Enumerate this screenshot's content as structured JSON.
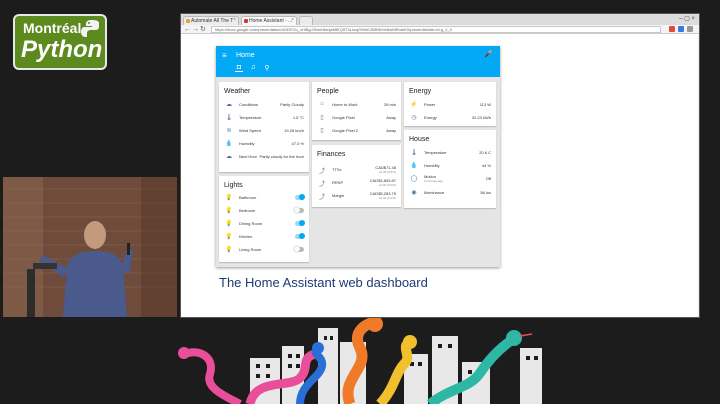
{
  "logo": {
    "line1": "Montréal",
    "line2": "Python"
  },
  "browser": {
    "tabs": [
      {
        "label": "Automate All The T",
        "active": false
      },
      {
        "label": "Home Assistant - ...",
        "active": true
      },
      {
        "label": "",
        "active": false
      }
    ],
    "url": "https://docs.google.com/presentation/d/1DFGu_xHlBgJ3NmHbmjaMtKQ5T3LkcqGWkK2BRNHxNfaMlRnrbiOi/present#slide=id.g_2_0"
  },
  "dashboard": {
    "header_title": "Home",
    "weather": {
      "title": "Weather",
      "rows": [
        {
          "icon": "☁",
          "name": "Conditions",
          "value": "Partly Cloudy"
        },
        {
          "icon": "🌡",
          "name": "Temperature",
          "value": "1.5 °C"
        },
        {
          "icon": "≋",
          "name": "Wind Speed",
          "value": "19.28 km/h"
        },
        {
          "icon": "💧",
          "name": "Humidity",
          "value": "47.0 %"
        },
        {
          "icon": "☁",
          "name": "Next Hour",
          "value": "Partly cloudy for the hour"
        }
      ]
    },
    "people": {
      "title": "People",
      "rows": [
        {
          "icon": "⌂",
          "name": "Home to Work",
          "value": "28 min"
        },
        {
          "icon": "▯",
          "name": "Google Pixel",
          "value": "Away"
        },
        {
          "icon": "▯",
          "name": "Google Pixel 2",
          "value": "Away"
        }
      ]
    },
    "energy": {
      "title": "Energy",
      "rows": [
        {
          "icon": "⚡",
          "name": "Power",
          "value": "113 W"
        },
        {
          "icon": "◷",
          "name": "Energy",
          "value": "32.23 kWh"
        }
      ]
    },
    "finances": {
      "title": "Finances",
      "rows": [
        {
          "icon": "⤴",
          "name": "TTSx",
          "value": "CAD$71.48",
          "sub": "+0.35 (0.5%)"
        },
        {
          "icon": "⤴",
          "name": "RRSP",
          "value": "CAD$3,853.87",
          "sub": "+0.00 (0.0%)"
        },
        {
          "icon": "⤴",
          "name": "Margin",
          "value": "CAD$5,283.75",
          "sub": "+0.00 (0.0%)"
        }
      ]
    },
    "house": {
      "title": "House",
      "rows": [
        {
          "icon": "🌡",
          "name": "Temperature",
          "value": "20.6 C",
          "sub": ""
        },
        {
          "icon": "💧",
          "name": "Humidity",
          "value": "44 %",
          "sub": ""
        },
        {
          "icon": "◯",
          "name": "Motion",
          "value": "Off",
          "sub": "3 minutes ago"
        },
        {
          "icon": "◉",
          "name": "Illuminance",
          "value": "58 lux",
          "sub": ""
        }
      ]
    },
    "lights": {
      "title": "Lights",
      "rows": [
        {
          "icon": "💡",
          "name": "Bathroom",
          "on": true
        },
        {
          "icon": "💡",
          "name": "Bedroom",
          "on": false
        },
        {
          "icon": "💡",
          "name": "Dining Room",
          "on": true
        },
        {
          "icon": "💡",
          "name": "Kitchen",
          "on": true
        },
        {
          "icon": "💡",
          "name": "Living Room",
          "on": false
        }
      ]
    }
  },
  "slide_caption": "The Home Assistant web dashboard",
  "colors": {
    "primary": "#03a9f4",
    "icon": "#44739e",
    "caption": "#1c3a72"
  }
}
